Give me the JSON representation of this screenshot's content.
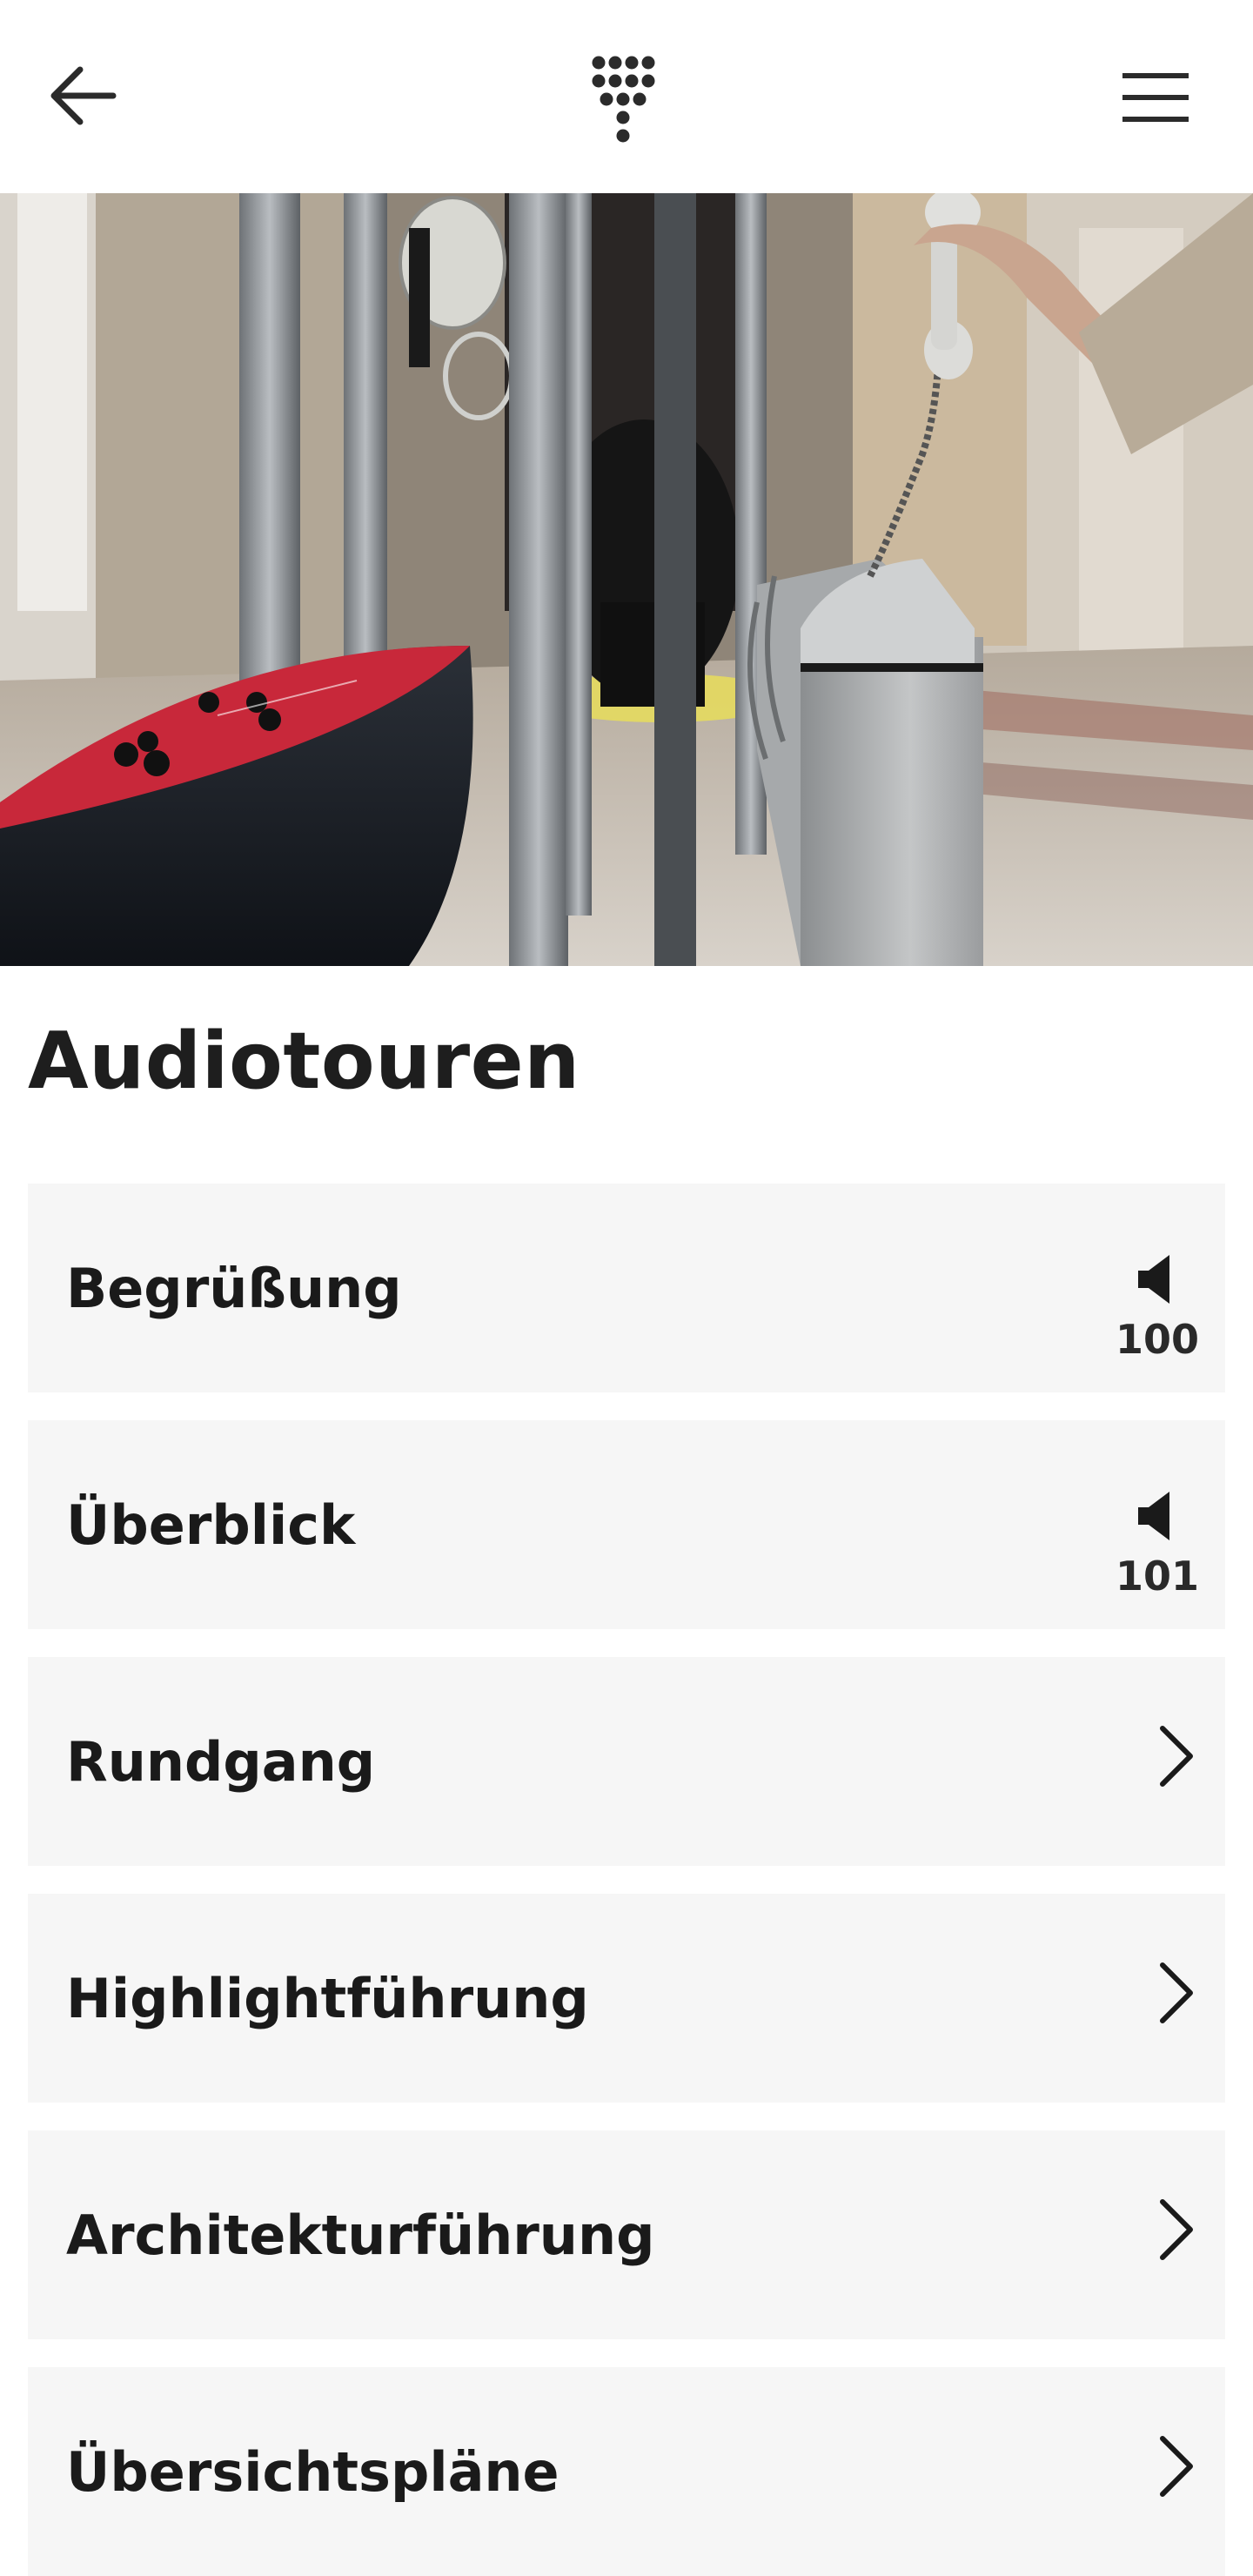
{
  "header": {
    "back_icon": "arrow-left-icon",
    "keypad_icon": "keypad-icon",
    "menu_icon": "hamburger-menu-icon"
  },
  "hero": {
    "image": "museum-exhibition-photo"
  },
  "page": {
    "title": "Audiotouren"
  },
  "tours": [
    {
      "label": "Begrüßung",
      "type": "audio",
      "number": "100",
      "icon": "speaker-icon"
    },
    {
      "label": "Überblick",
      "type": "audio",
      "number": "101",
      "icon": "speaker-icon"
    },
    {
      "label": "Rundgang",
      "type": "link",
      "icon": "chevron-right-icon"
    },
    {
      "label": "Highlightführung",
      "type": "link",
      "icon": "chevron-right-icon"
    },
    {
      "label": "Architekturführung",
      "type": "link",
      "icon": "chevron-right-icon"
    },
    {
      "label": "Übersichtspläne",
      "type": "link",
      "icon": "chevron-right-icon"
    }
  ],
  "colors": {
    "background": "#ffffff",
    "list_item_bg": "#f6f6f6",
    "text": "#1a1a1a"
  }
}
